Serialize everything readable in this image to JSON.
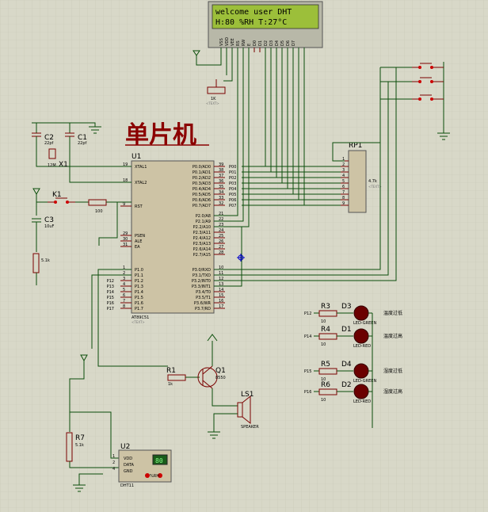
{
  "title": "单片机",
  "lcd": {
    "line1": "welcome user DHT",
    "line2": "H:80 %RH T:27°C",
    "pins": [
      "VSS",
      "VDD",
      "VEE",
      "RS",
      "RW",
      "E",
      "D0",
      "D1",
      "D2",
      "D3",
      "D4",
      "D5",
      "D6",
      "D7"
    ]
  },
  "mcu": {
    "ref": "U1",
    "part": "AT89C51",
    "left_pins": [
      "XTAL1",
      "XTAL2",
      "RST",
      "PSEN",
      "ALE",
      "EA",
      "P1.0",
      "P1.1",
      "P1.2",
      "P1.3",
      "P1.4",
      "P1.5",
      "P1.6",
      "P1.7"
    ],
    "left_nums": [
      "19",
      "18",
      "9",
      "29",
      "30",
      "31",
      "1",
      "2",
      "3",
      "4",
      "5",
      "6",
      "7",
      "8"
    ],
    "right_p0": [
      "P0.0/AD0",
      "P0.1/AD1",
      "P0.2/AD2",
      "P0.3/AD3",
      "P0.4/AD4",
      "P0.5/AD5",
      "P0.6/AD6",
      "P0.7/AD7"
    ],
    "right_p2": [
      "P2.0/A8",
      "P2.1/A9",
      "P2.2/A10",
      "P2.3/A11",
      "P2.4/A12",
      "P2.5/A13",
      "P2.6/A14",
      "P2.7/A15"
    ],
    "right_p3": [
      "P3.0/RXD",
      "P3.1/TXD",
      "P3.2/INT0",
      "P3.3/INT1",
      "P3.4/T0",
      "P3.5/T1",
      "P3.6/WR",
      "P3.7/RD"
    ],
    "p0_nums": [
      "39",
      "38",
      "37",
      "36",
      "35",
      "34",
      "33",
      "32"
    ],
    "p2_nums": [
      "21",
      "22",
      "23",
      "24",
      "25",
      "26",
      "27",
      "28"
    ],
    "p3_nums": [
      "10",
      "11",
      "12",
      "13",
      "14",
      "15",
      "16",
      "17"
    ],
    "net_labels": [
      "P00",
      "P01",
      "P02",
      "P03",
      "P04",
      "P05",
      "P06",
      "P07"
    ],
    "p1_labels": [
      "P12",
      "P13",
      "P14",
      "P15",
      "P16",
      "P17"
    ]
  },
  "components": {
    "c2": {
      "ref": "C2",
      "value": "22pf"
    },
    "c1": {
      "ref": "C1",
      "value": "22pf"
    },
    "x1": {
      "ref": "X1",
      "value": "12M"
    },
    "k1": {
      "ref": "K1"
    },
    "c3": {
      "ref": "C3",
      "value": "10uF"
    },
    "r100": {
      "value": "100"
    },
    "r51k": {
      "value": "5.1k"
    },
    "rp1": {
      "ref": "RP1",
      "value": "4.7k",
      "pins": [
        "1",
        "2",
        "3",
        "4",
        "5",
        "6",
        "7",
        "8",
        "9"
      ]
    },
    "rpot": {
      "value": "1K"
    },
    "r1": {
      "ref": "R1",
      "value": "1k"
    },
    "q1": {
      "ref": "Q1",
      "value": "8550"
    },
    "ls1": {
      "ref": "LS1",
      "value": "SPEAKER"
    },
    "r7": {
      "ref": "R7",
      "value": "5.1k"
    },
    "u2": {
      "ref": "U2",
      "part": "DHT11",
      "pins": [
        "VDD",
        "DATA",
        "GND"
      ],
      "pin_nums": [
        "1",
        "2",
        "4"
      ],
      "display": "80",
      "unit": "%RH"
    },
    "leds": [
      {
        "r": "R3",
        "rv": "10",
        "d": "D3",
        "dv": "LED-GREEN",
        "net": "P12",
        "note": "温度过低"
      },
      {
        "r": "R4",
        "rv": "10",
        "d": "D1",
        "dv": "LED-RED",
        "net": "P14",
        "note": "温度过高"
      },
      {
        "r": "R5",
        "rv": "10",
        "d": "D4",
        "dv": "LED-GREEN",
        "net": "P15",
        "note": "湿度过低"
      },
      {
        "r": "R6",
        "rv": "10",
        "d": "D2",
        "dv": "LED-RED",
        "net": "P16",
        "note": "湿度过高"
      }
    ]
  },
  "text_hint": "<TEXT>",
  "colors": {
    "bg": "#d8d8c8",
    "wire": "#0a4d0a",
    "part": "#7a0000",
    "lcd": "#9cbf3a",
    "chip": "#cdc3a5"
  }
}
